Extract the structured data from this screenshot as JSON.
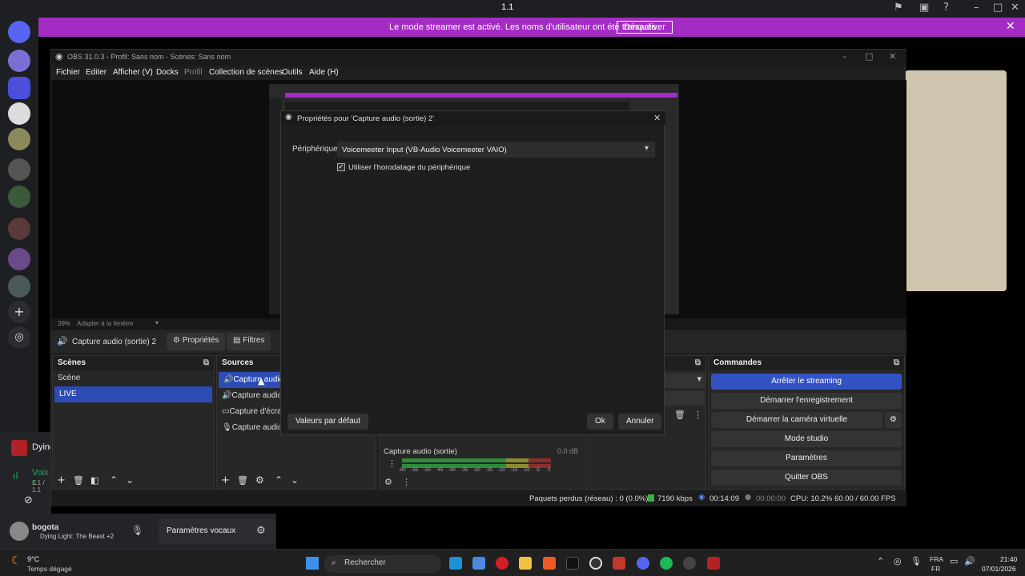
{
  "discord": {
    "window_title": "1.1",
    "streamer_banner": {
      "message": "Le mode streamer est activé. Les noms d'utilisateur ont été tronqués.",
      "button": "Désactiver"
    },
    "voice": {
      "game": "Dying",
      "status": "Voix c",
      "sub": "1.1 / 1.1"
    },
    "user": {
      "name": "bogota",
      "activity": "Dying Light: The Beast +2",
      "voice_settings": "Paramètres vocaux"
    },
    "channel_header": "1.1"
  },
  "obs": {
    "title": "OBS 31.0.3 - Profil: Sans nom - Scènes: Sans nom",
    "menu": [
      "Fichier",
      "Editer",
      "Afficher (V)",
      "Docks",
      "Profil",
      "Collection de scènes",
      "Outils",
      "Aide (H)"
    ],
    "preview_bar": {
      "zoom": "39%",
      "fit": "Adapter à la fenêtre"
    },
    "source_toolbar": {
      "selected_source": "Capture audio (sortie) 2",
      "properties": "Propriétés",
      "filters": "Filtres"
    },
    "scenes": {
      "title": "Scènes",
      "items": [
        "Scène",
        "LIVE"
      ],
      "selected": "LIVE"
    },
    "sources": {
      "title": "Sources",
      "items": [
        "Capture audio (",
        "Capture audio (",
        "Capture d'écran",
        "Capture audio ("
      ]
    },
    "mixer": {
      "track_name": "Capture audio (sortie)",
      "level": "0.0 dB",
      "scale": [
        "-60",
        "-55",
        "-50",
        "-45",
        "-40",
        "-35",
        "-30",
        "-25",
        "-20",
        "-15",
        "-10",
        "-5",
        "0"
      ]
    },
    "commands": {
      "title": "Commandes",
      "buttons": [
        "Arrêter le streaming",
        "Démarrer l'enregistrement",
        "Démarrer la caméra virtuelle",
        "Mode studio",
        "Paramètres",
        "Quitter OBS"
      ]
    },
    "status": {
      "dropped": "Paquets perdus (réseau) : 0 (0.0%)",
      "bitrate": "7190 kbps",
      "stream_time": "00:14:09",
      "rec_time": "00:00:00",
      "cpu": "CPU: 10.2%",
      "fps": "60.00 / 60.00 FPS"
    }
  },
  "dialog": {
    "title": "Propriétés pour 'Capture audio (sortie) 2'",
    "device_label": "Périphérique",
    "device_value": "Voicemeeter Input (VB-Audio Voicemeeter VAIO)",
    "checkbox_label": "Utiliser l'horodatage du périphérique",
    "checkbox_checked": true,
    "defaults_button": "Valeurs par défaut",
    "ok_button": "Ok",
    "cancel_button": "Annuler"
  },
  "taskbar": {
    "weather_temp": "9°C",
    "weather_desc": "Temps dégagé",
    "search_placeholder": "Rechercher",
    "lang_top": "FRA",
    "lang_bottom": "FR",
    "time": "21:40",
    "date": "07/01/2026"
  },
  "colors": {
    "accent": "#3352c3",
    "streamer": "#a32cc4"
  }
}
